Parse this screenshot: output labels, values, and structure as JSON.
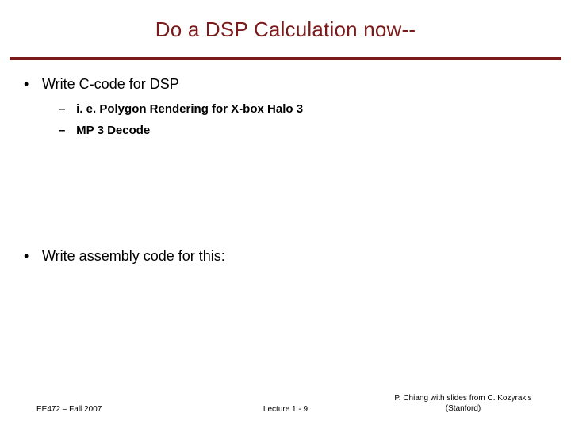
{
  "title": "Do a DSP Calculation now--",
  "bullets": {
    "b1": "Write C-code for DSP",
    "b1_subs": [
      "i. e. Polygon Rendering for X-box Halo 3",
      "MP 3 Decode"
    ],
    "b2": "Write assembly code for this:"
  },
  "footer": {
    "left": "EE472 – Fall 2007",
    "center": "Lecture 1 - 9",
    "right": "P. Chiang with slides from C. Kozyrakis (Stanford)"
  }
}
